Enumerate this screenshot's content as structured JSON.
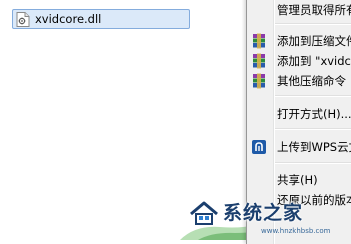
{
  "explorer": {
    "file_name": "xvidcore.dll"
  },
  "context_menu": {
    "items": [
      {
        "label": "管理员取得所有",
        "icon": ""
      },
      {
        "label": "添加到压缩文件",
        "icon": "winrar-icon"
      },
      {
        "label": "添加到 \"xvidco",
        "icon": "winrar-icon"
      },
      {
        "label": "其他压缩命令",
        "icon": "winrar-icon"
      },
      {
        "label": "打开方式(H)...",
        "icon": ""
      },
      {
        "label": "上传到WPS云文",
        "icon": "wps-cloud-icon"
      },
      {
        "label": "共享(H)",
        "icon": ""
      },
      {
        "label": "还原以前的版本",
        "icon": ""
      }
    ]
  },
  "watermark": {
    "title": "系统之家",
    "url": "www.hnzkhbsb.com"
  },
  "colors": {
    "selection_bg": "#dbe9f9",
    "selection_border": "#84acdd",
    "menu_bg": "#f0f0f0",
    "wps_blue": "#1e5aa8",
    "watermark_blue": "#1b3f6e"
  }
}
